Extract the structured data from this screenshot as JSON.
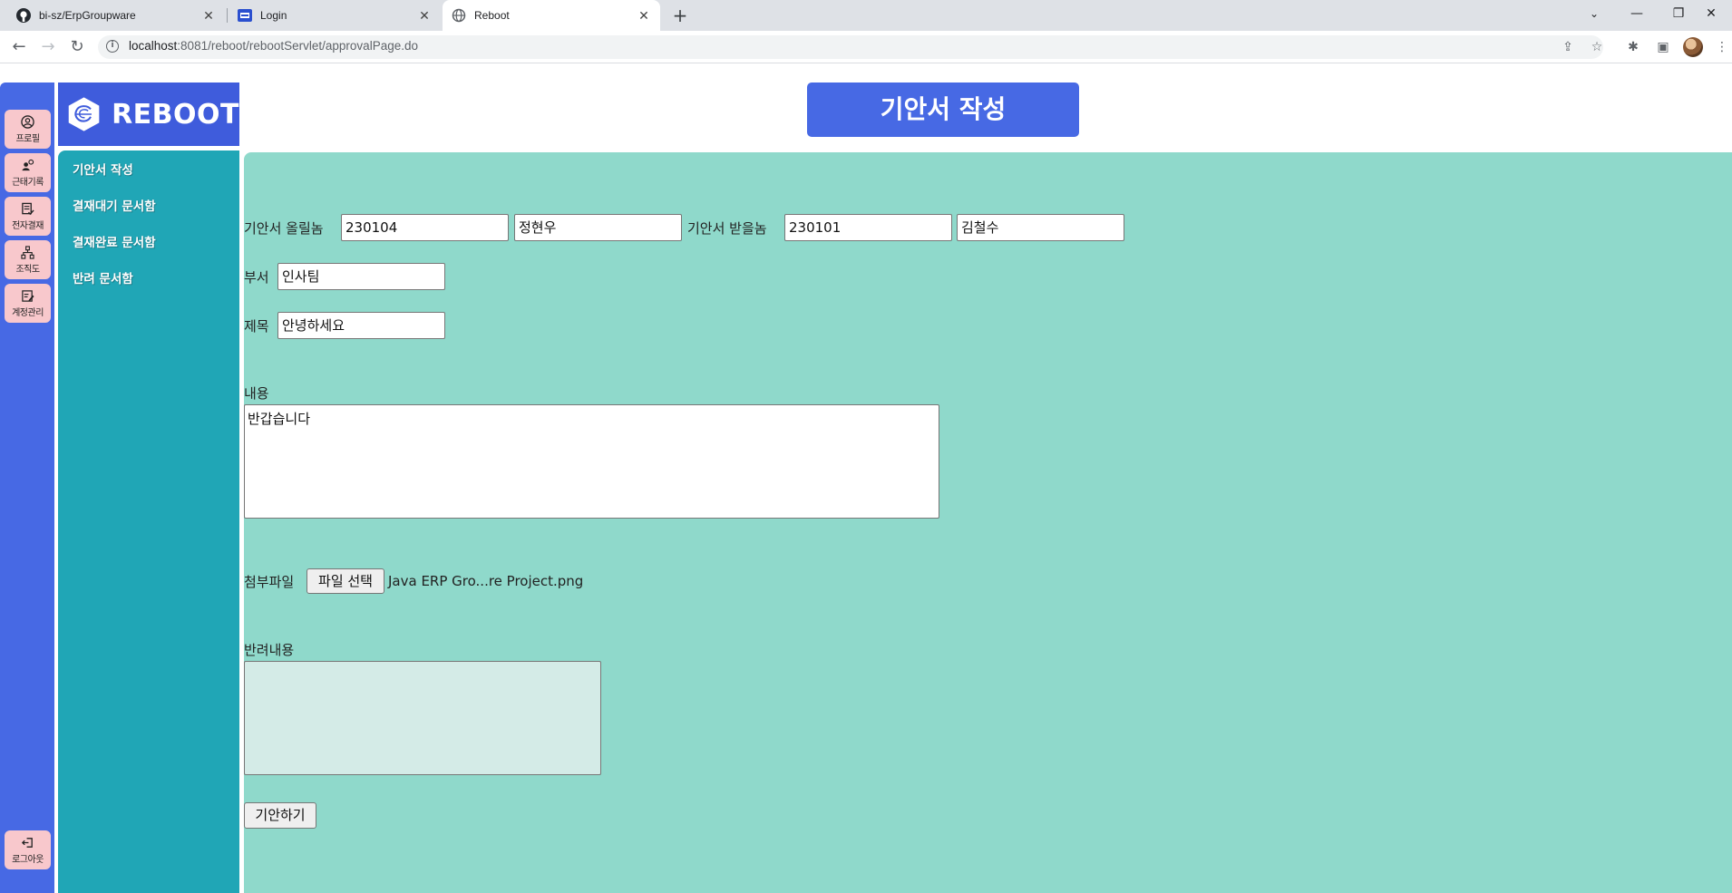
{
  "browser": {
    "tabs": [
      {
        "title": "bi-sz/ErpGroupware",
        "icon": "github-icon"
      },
      {
        "title": "Login",
        "icon": "site-icon"
      },
      {
        "title": "Reboot",
        "icon": "globe-icon",
        "active": true
      }
    ],
    "url_host": "localhost",
    "url_rest": ":8081/reboot/rebootServlet/approvalPage.do"
  },
  "rail": {
    "items": [
      {
        "label": "프로필",
        "icon": "profile-icon"
      },
      {
        "label": "근태기록",
        "icon": "attendance-icon"
      },
      {
        "label": "전자결재",
        "icon": "approval-icon"
      },
      {
        "label": "조직도",
        "icon": "org-chart-icon"
      },
      {
        "label": "계정관리",
        "icon": "account-icon"
      }
    ],
    "logout_label": "로그아웃"
  },
  "logo": {
    "text": "REBOOT"
  },
  "sidebar": {
    "items": [
      {
        "label": "기안서 작성"
      },
      {
        "label": "결재대기 문서함"
      },
      {
        "label": "결재완료 문서함"
      },
      {
        "label": "반려 문서함"
      }
    ]
  },
  "page": {
    "title": "기안서 작성"
  },
  "form": {
    "sender_label": "기안서 올릴놈",
    "sender_id": "230104",
    "sender_name": "정현우",
    "receiver_label": "기안서 받을놈",
    "receiver_id": "230101",
    "receiver_name": "김철수",
    "dept_label": "부서",
    "dept_value": "인사팀",
    "subject_label": "제목",
    "subject_value": "안녕하세요",
    "content_label": "내용",
    "content_value": "반갑습니다",
    "attach_label": "첨부파일",
    "file_button": "파일 선택",
    "file_name": "Java ERP Gro...re Project.png",
    "reject_label": "반려내용",
    "reject_value": "",
    "submit_label": "기안하기"
  },
  "colors": {
    "rail": "#4769e4",
    "sidebar": "#20a6b6",
    "content": "#8fd9cb",
    "rail_item": "#f8c8cc",
    "title_bg": "#4769e4"
  }
}
